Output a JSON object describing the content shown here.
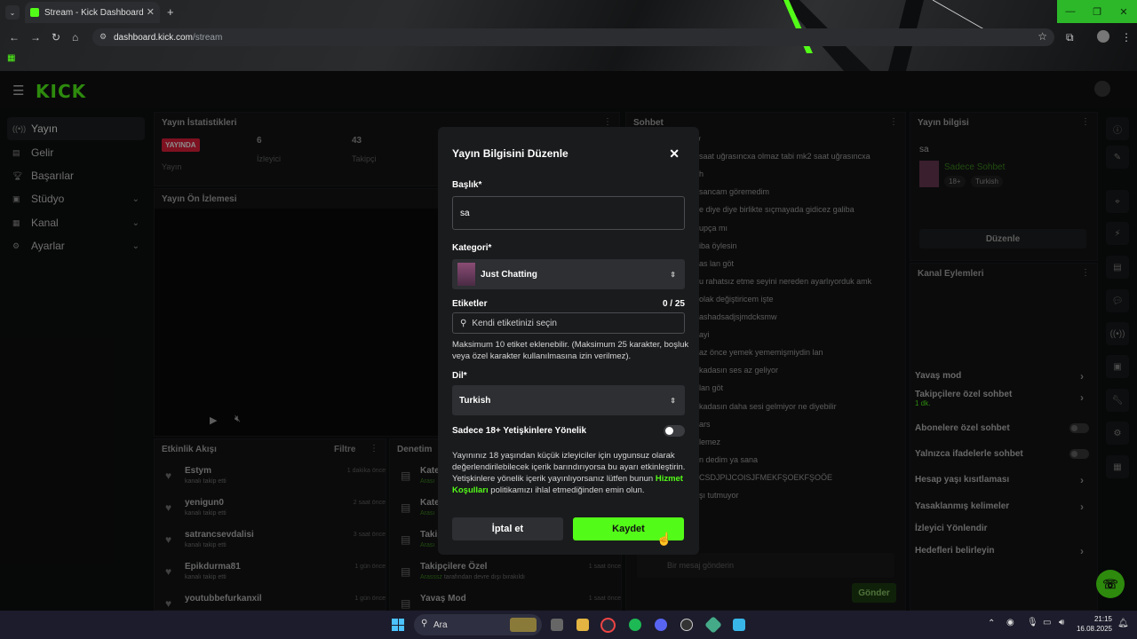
{
  "browser": {
    "tab_title": "Stream - Kick Dashboard",
    "url_host": "dashboard.kick.com",
    "url_path": "/stream"
  },
  "app": {
    "logo": "KICK",
    "sidebar": [
      {
        "label": "Yayın",
        "icon": "broadcast-icon",
        "active": true
      },
      {
        "label": "Gelir",
        "icon": "revenue-icon"
      },
      {
        "label": "Başarılar",
        "icon": "trophy-icon"
      },
      {
        "label": "Stüdyo",
        "icon": "studio-icon",
        "chevron": true
      },
      {
        "label": "Kanal",
        "icon": "channel-icon",
        "chevron": true
      },
      {
        "label": "Ayarlar",
        "icon": "gear-icon",
        "chevron": true
      }
    ],
    "stats": {
      "title": "Yayın İstatistikleri",
      "live_badge": "YAYINDA",
      "live_label": "Yayın",
      "viewers_value": "6",
      "viewers_label": "İzleyici",
      "followers_value": "43",
      "followers_label": "Takipçi"
    },
    "preview_title": "Yayın Ön İzlemesi",
    "activity": {
      "title": "Etkinlik Akışı",
      "filter": "Filtre",
      "items": [
        {
          "name": "Estym",
          "sub": "kanalı takip etti",
          "time": "1 dakika önce"
        },
        {
          "name": "yenigun0",
          "sub": "kanalı takip etti",
          "time": "2 saat önce"
        },
        {
          "name": "satrancsevdalisi",
          "sub": "kanalı takip etti",
          "time": "3 saat önce"
        },
        {
          "name": "Epikdurma81",
          "sub": "kanalı takip etti",
          "time": "1 gün önce"
        },
        {
          "name": "youtubbefurkanxil",
          "sub": "",
          "time": "1 gün önce"
        }
      ]
    },
    "audit": {
      "title": "Denetim",
      "items": [
        {
          "name": "Kate",
          "sub": "Arası",
          "time": ""
        },
        {
          "name": "Kate",
          "sub": "Arası",
          "time": ""
        },
        {
          "name": "Takip",
          "sub": "Arası",
          "time": ""
        },
        {
          "name": "Takipçilere Özel",
          "sub_green": "Arasssz",
          "sub": " tarafından devre dışı bırakıldı",
          "time": "1 saat önce"
        },
        {
          "name": "Yavaş Mod",
          "sub": "",
          "time": "1 saat önce"
        }
      ]
    },
    "chat": {
      "title": "Sohbet",
      "lines": [
        "rweyw",
        "saat uğrasıncxa olmaz tabi mk2 saat uğrasıncxa",
        "h",
        "sancam göremedim",
        "e diye diye birlikte sıçmayada gidicez galiba",
        "upça mı",
        "iba öylesin",
        "as lan göt",
        "u rahatsız etme seyini nereden ayarlıyorduk amk",
        "olak değiştiricem işte",
        "ashadsadjsjmdcksmw",
        "ayi",
        "az önce yemek yememişmiydin lan",
        "kadasın ses az geliyor",
        "lan göt",
        "kadasın daha sesi gelmiyor ne diyebilir",
        "ars",
        "lemez",
        "n dedim ya sana",
        "CSDJPIJCOISJFMEKFŞOEKFŞOÖE",
        "şı tutmuyor"
      ],
      "input_placeholder": "Bir mesaj gönderin",
      "send": "Gönder"
    },
    "stream_info": {
      "title": "Yayın bilgisi",
      "stream_title": "sa",
      "category": "Sadece Sohbet",
      "tag1": "18+",
      "tag2": "Turkish",
      "edit": "Düzenle"
    },
    "channel_actions": {
      "title": "Kanal Eylemleri",
      "items": [
        {
          "label": "Yavaş mod",
          "kind": "chevron"
        },
        {
          "label": "Takipçilere özel sohbet",
          "sub": "1 dk.",
          "kind": "chevron"
        },
        {
          "label": "Abonelere özel sohbet",
          "kind": "toggle"
        },
        {
          "label": "Yalnızca ifadelerle sohbet",
          "kind": "toggle"
        },
        {
          "label": "Hesap yaşı kısıtlaması",
          "kind": "chevron"
        },
        {
          "label": "Yasaklanmış kelimeler",
          "kind": "chevron"
        },
        {
          "label": "İzleyici Yönlendir",
          "kind": "none"
        },
        {
          "label": "Hedefleri belirleyin",
          "kind": "chevron"
        }
      ]
    }
  },
  "modal": {
    "title": "Yayın Bilgisini Düzenle",
    "title_label": "Başlık*",
    "title_value": "sa",
    "category_label": "Kategori*",
    "category_value": "Just Chatting",
    "tags_label": "Etiketler",
    "tags_count": "0 / 25",
    "tags_placeholder": "Kendi etiketinizi seçin",
    "tags_help": "Maksimum 10 etiket eklenebilir. (Maksimum 25 karakter, boşluk veya özel karakter kullanılmasına izin verilmez).",
    "language_label": "Dil*",
    "language_value": "Turkish",
    "adult_label": "Sadece 18+ Yetişkinlere Yönelik",
    "adult_on": false,
    "warning_before": "Yayınınız 18 yaşından küçük izleyiciler için uygunsuz olarak değerlendirilebilecek içerik barındırıyorsa bu ayarı etkinleştirin. Yetişkinlere yönelik içerik yayınlıyorsanız lütfen bunun ",
    "warning_link": "Hizmet Koşulları",
    "warning_after": " politikamızı ihlal etmediğinden emin olun.",
    "cancel": "İptal et",
    "save": "Kaydet"
  },
  "taskbar": {
    "search": "Ara",
    "time": "21:15",
    "date": "16.08.2025",
    "accent": "#53fc18"
  }
}
